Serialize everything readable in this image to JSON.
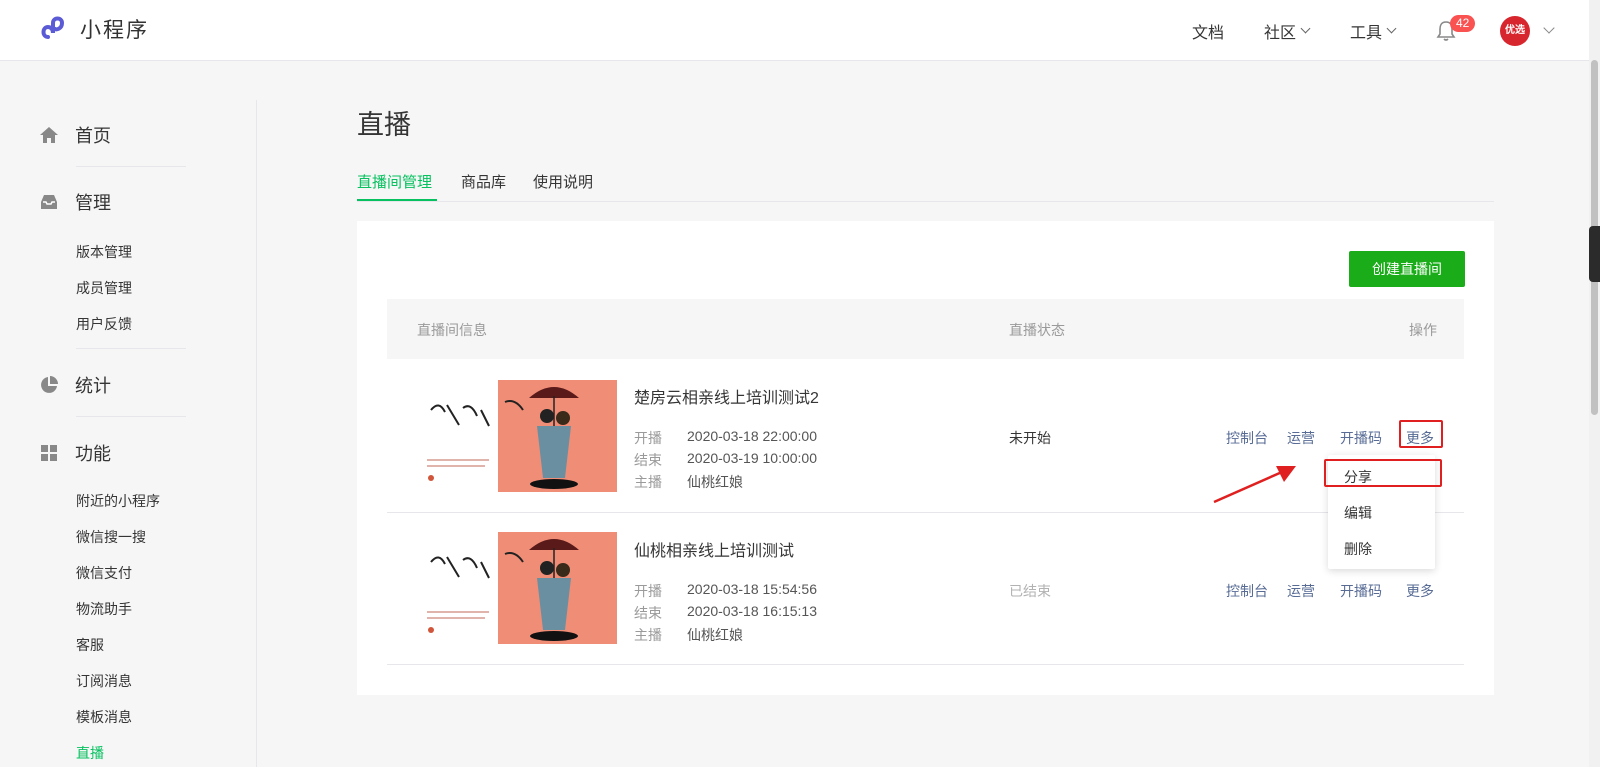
{
  "header": {
    "logo_text": "小程序",
    "nav": [
      "文档",
      "社区",
      "工具"
    ],
    "notification_count": "42",
    "avatar_text": "优选"
  },
  "sidebar": {
    "sections": [
      {
        "label": "首页",
        "icon": "home-icon"
      },
      {
        "label": "管理",
        "icon": "inbox-icon",
        "items": [
          "版本管理",
          "成员管理",
          "用户反馈"
        ]
      },
      {
        "label": "统计",
        "icon": "pie-chart-icon"
      },
      {
        "label": "功能",
        "icon": "grid-icon",
        "items": [
          "附近的小程序",
          "微信搜一搜",
          "微信支付",
          "物流助手",
          "客服",
          "订阅消息",
          "模板消息",
          "直播"
        ]
      }
    ],
    "active_item": "直播"
  },
  "page": {
    "title": "直播",
    "tabs": [
      "直播间管理",
      "商品库",
      "使用说明"
    ],
    "active_tab": "直播间管理",
    "create_button": "创建直播间"
  },
  "table": {
    "headers": [
      "直播间信息",
      "直播状态",
      "操作"
    ],
    "meta_labels": [
      "开播",
      "结束",
      "主播"
    ],
    "rows": [
      {
        "title": "楚房云相亲线上培训测试2",
        "start": "2020-03-18 22:00:00",
        "end": "2020-03-19 10:00:00",
        "anchor": "仙桃红娘",
        "status": "未开始",
        "status_color": "#353535"
      },
      {
        "title": "仙桃相亲线上培训测试",
        "start": "2020-03-18 15:54:56",
        "end": "2020-03-18 16:15:13",
        "anchor": "仙桃红娘",
        "status": "已结束",
        "status_color": "#b2b2b2"
      }
    ],
    "actions": [
      "控制台",
      "运营",
      "开播码",
      "更多"
    ]
  },
  "more_menu": {
    "items": [
      "分享",
      "编辑",
      "删除"
    ]
  },
  "colors": {
    "accent_green": "#07c160",
    "button_green": "#1aad19",
    "link_blue": "#576b95",
    "highlight_red": "#e02020"
  }
}
